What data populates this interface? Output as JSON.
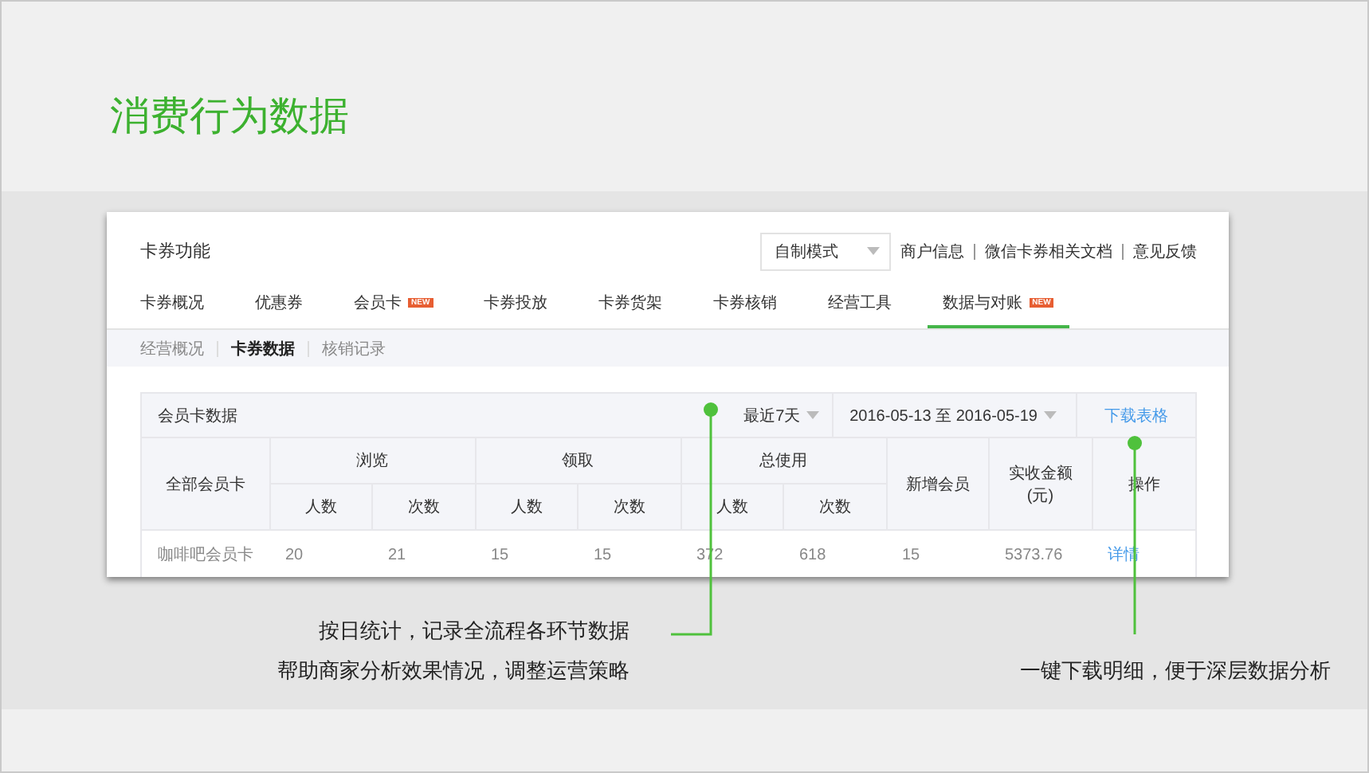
{
  "title": "消费行为数据",
  "panel": {
    "title": "卡券功能",
    "mode_select": {
      "value": "自制模式"
    },
    "links": [
      "商户信息",
      "微信卡券相关文档",
      "意见反馈"
    ],
    "tabs": [
      {
        "label": "卡券概况",
        "selected": false
      },
      {
        "label": "优惠券",
        "selected": false
      },
      {
        "label": "会员卡",
        "selected": false,
        "badge": "NEW"
      },
      {
        "label": "卡券投放",
        "selected": false
      },
      {
        "label": "卡券货架",
        "selected": false
      },
      {
        "label": "卡券核销",
        "selected": false
      },
      {
        "label": "经营工具",
        "selected": false
      },
      {
        "label": "数据与对账",
        "selected": true,
        "badge": "NEW"
      }
    ],
    "subtabs": [
      {
        "label": "经营概况",
        "selected": false
      },
      {
        "label": "卡券数据",
        "selected": true
      },
      {
        "label": "核销记录",
        "selected": false
      }
    ],
    "table": {
      "title": "会员卡数据",
      "range_select": {
        "value": "最近7天"
      },
      "date_range": {
        "value": "2016-05-13 至 2016-05-19"
      },
      "download_link": "下载表格",
      "columns": [
        {
          "label": "全部会员卡"
        },
        {
          "label": "浏览",
          "colspan": 2,
          "sub": [
            "人数",
            "次数"
          ]
        },
        {
          "label": "领取",
          "colspan": 2,
          "sub": [
            "人数",
            "次数"
          ]
        },
        {
          "label": "总使用",
          "colspan": 2,
          "sub": [
            "人数",
            "次数"
          ]
        },
        {
          "label": "新增会员"
        },
        {
          "label": "实收金额(元)"
        },
        {
          "label": "操作"
        }
      ],
      "rows": [
        {
          "cells": [
            "咖啡吧会员卡",
            "20",
            "21",
            "15",
            "15",
            "372",
            "618",
            "15",
            "5373.76"
          ],
          "action": "详情"
        }
      ]
    }
  },
  "callouts": [
    {
      "lines": [
        "按日统计，记录全流程各环节数据",
        "帮助商家分析效果情况，调整运营策略"
      ]
    },
    {
      "lines": [
        "一键下载明细，便于深层数据分析"
      ]
    }
  ]
}
